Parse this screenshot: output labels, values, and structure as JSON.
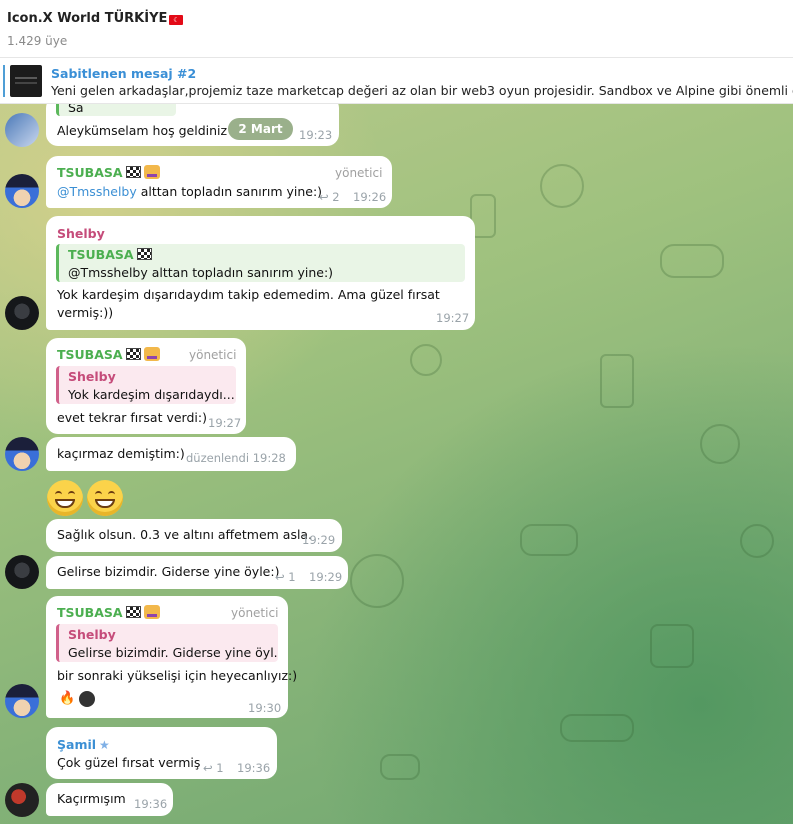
{
  "header": {
    "title": "Icon.X World TÜRKİYE",
    "members": "1.429 üye"
  },
  "pinned": {
    "title": "Sabitlenen mesaj #2",
    "text": "Yeni gelen arkadaşlar,projemiz taze marketcap değeri az olan bir web3 oyun projesidir. Sandbox ve Alpine gibi önemli ortaklıkları"
  },
  "date_pill": "2 Mart",
  "messages": [
    {
      "quote_fragment": "Sa",
      "text": "Aleykümselam hoş geldiniz",
      "time": "19:23"
    },
    {
      "sender": "TSUBASA",
      "role": "yönetici",
      "mention": "@Tmsshelby",
      "text": " alttan topladın sanırım yine:)",
      "replies": "2",
      "time": "19:26"
    },
    {
      "sender": "Shelby",
      "quote_name": "TSUBASA",
      "quote_text": "@Tmsshelby alttan topladın sanırım yine:)",
      "text_line1": "Yok kardeşim dışarıdaydım takip edemedim. Ama güzel fırsat",
      "text_line2": "vermiş:))",
      "time": "19:27"
    },
    {
      "sender": "TSUBASA",
      "role": "yönetici",
      "quote_name": "Shelby",
      "quote_text": "Yok kardeşim dışarıdaydı...",
      "text": "evet tekrar fırsat verdi:)",
      "time": "19:27"
    },
    {
      "text": "kaçırmaz demiştim:)",
      "time": "düzenlendi 19:28"
    },
    {
      "emoji": "grinning-face-x2"
    },
    {
      "text": "Sağlık olsun. 0.3 ve altını affetmem asla.",
      "time": "19:29"
    },
    {
      "text": "Gelirse bizimdir. Giderse yine öyle:)",
      "replies": "1",
      "time": "19:29"
    },
    {
      "sender": "TSUBASA",
      "role": "yönetici",
      "quote_name": "Shelby",
      "quote_text": "Gelirse bizimdir. Giderse yine öyl...",
      "text": "bir sonraki yükselişi için heyecanlıyız:)",
      "time": "19:30"
    },
    {
      "sender": "Şamil",
      "text": "Çok güzel fırsat vermiş",
      "replies": "1",
      "time": "19:36"
    },
    {
      "text": "Kaçırmışım",
      "time": "19:36"
    }
  ],
  "colors": {
    "accent": "#3a8fd6",
    "admin_name": "#4caf50",
    "shelby_name": "#c54c7a",
    "bubble": "#ffffff"
  }
}
